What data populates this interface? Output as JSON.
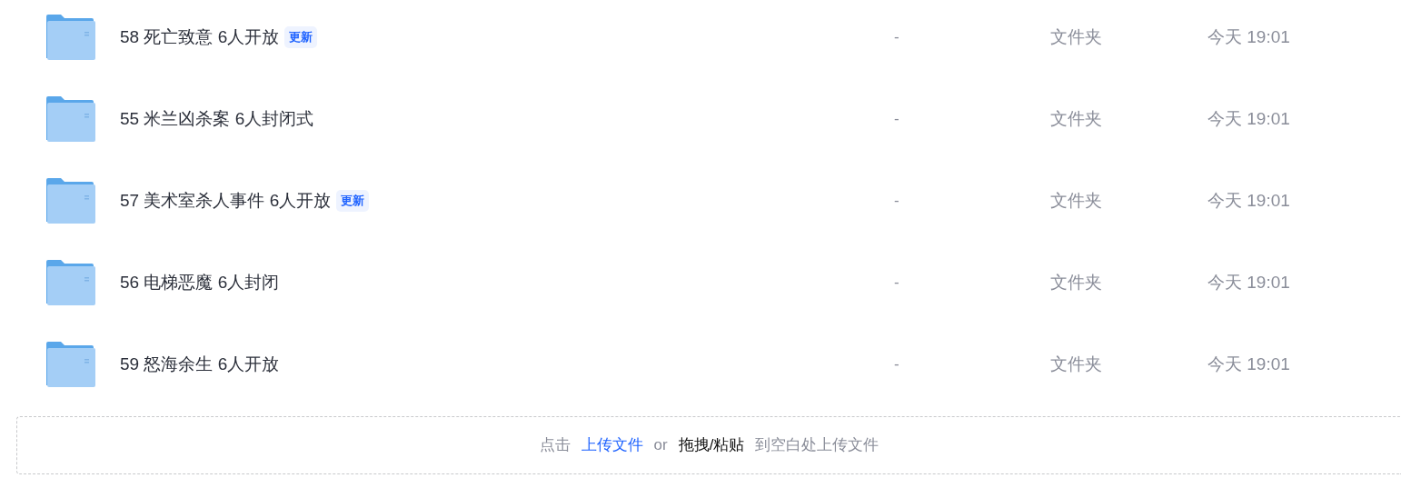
{
  "files": [
    {
      "name": "58 死亡致意 6人开放",
      "badge": "更新",
      "size": "-",
      "type": "文件夹",
      "modified": "今天 19:01"
    },
    {
      "name": "55 米兰凶杀案 6人封闭式",
      "size": "-",
      "type": "文件夹",
      "modified": "今天 19:01"
    },
    {
      "name": "57 美术室杀人事件 6人开放",
      "badge": "更新",
      "size": "-",
      "type": "文件夹",
      "modified": "今天 19:01"
    },
    {
      "name": "56 电梯恶魔 6人封闭",
      "size": "-",
      "type": "文件夹",
      "modified": "今天 19:01"
    },
    {
      "name": "59 怒海余生 6人开放",
      "size": "-",
      "type": "文件夹",
      "modified": "今天 19:01"
    }
  ],
  "upload_hint": {
    "prefix": "点击",
    "link": "上传文件",
    "or": "or",
    "action": "拖拽/粘贴",
    "suffix": "到空白处上传文件"
  }
}
